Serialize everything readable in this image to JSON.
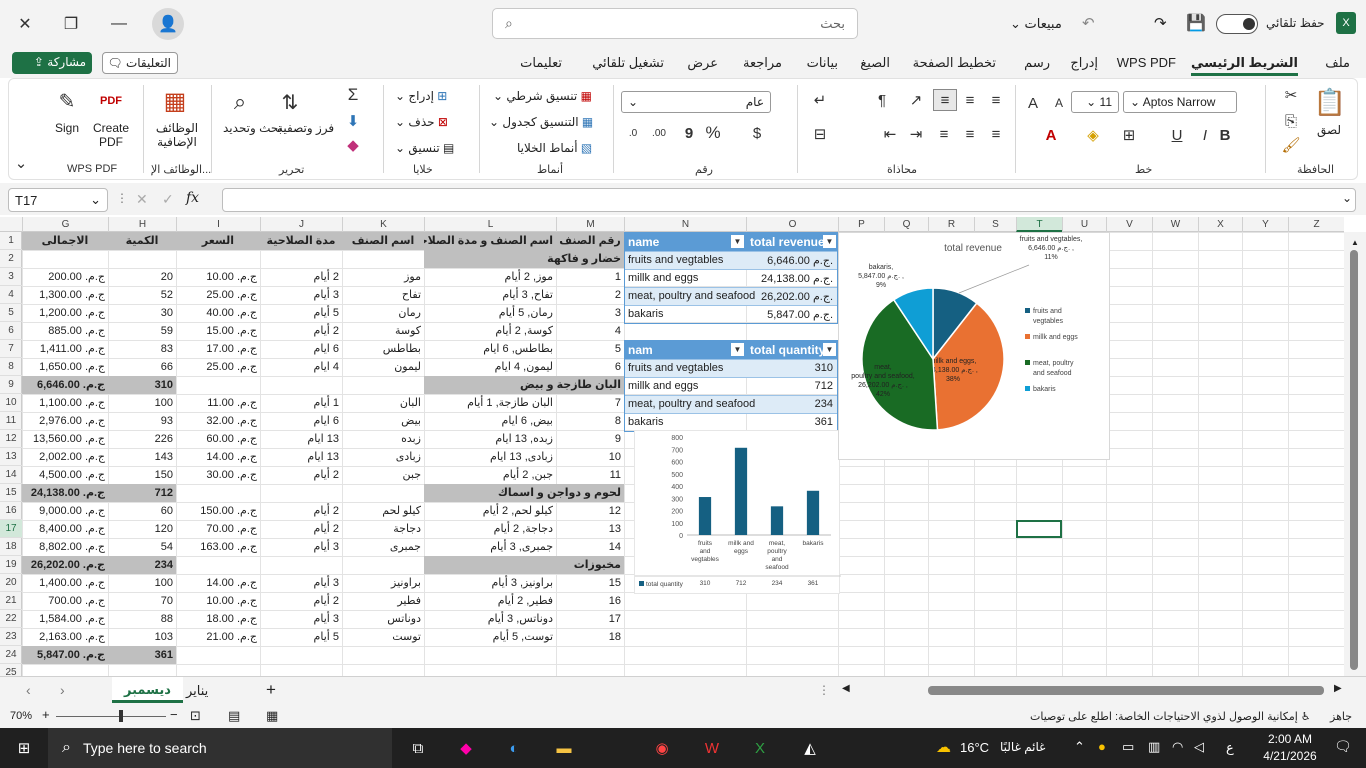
{
  "app": {
    "title": "مبيعات",
    "autosave": "حفظ تلقائي",
    "search_placeholder": "بحث"
  },
  "menu": [
    "ملف",
    "الشريط الرئيسي",
    "WPS PDF",
    "إدراج",
    "رسم",
    "تخطيط الصفحة",
    "الصيغ",
    "بيانات",
    "مراجعة",
    "عرض",
    "تشغيل تلقائي",
    "تعليمات"
  ],
  "actions": {
    "comments": "التعليقات",
    "share": "مشاركة"
  },
  "ribbon": {
    "clipboard": {
      "label": "الحافظة",
      "paste": "لصق"
    },
    "font": {
      "label": "خط",
      "name": "Aptos Narrow",
      "size": "11"
    },
    "align": {
      "label": "محاذاة"
    },
    "number": {
      "label": "رقم",
      "format": "عام"
    },
    "styles": {
      "label": "أنماط",
      "cond": "تنسيق شرطي",
      "table": "التنسيق كجدول",
      "cell": "أنماط الخلايا"
    },
    "cells": {
      "label": "خلايا",
      "insert": "إدراج",
      "delete": "حذف",
      "format": "تنسيق"
    },
    "edit": {
      "label": "تحرير",
      "sort": "فرز وتصفية",
      "find": "بحث وتحديد"
    },
    "addins": {
      "label": "الوظائف الإ...",
      "btn": "الوظائف الإضافية"
    },
    "wps": {
      "label": "WPS PDF",
      "create": "Create PDF",
      "sign": "Sign"
    }
  },
  "namebox": "T17",
  "columns": [
    "G",
    "H",
    "I",
    "J",
    "K",
    "L",
    "M",
    "N",
    "O",
    "P",
    "Q",
    "R",
    "S",
    "T",
    "U",
    "V",
    "W",
    "X",
    "Y",
    "Z"
  ],
  "rows": [
    "1",
    "2",
    "3",
    "4",
    "5",
    "6",
    "7",
    "8",
    "9",
    "10",
    "11",
    "12",
    "13",
    "14",
    "15",
    "16",
    "17",
    "18",
    "19",
    "20",
    "21",
    "22",
    "23",
    "24",
    "25"
  ],
  "table_header": {
    "total": "الاجمالى",
    "qty": "الكمية",
    "price": "السعر",
    "exp": "مدة الصلاحية",
    "name": "اسم الصنف",
    "combined": "اسم الصنف و مدة الصلاحية",
    "num": "رقم الصنف"
  },
  "table_rows": [
    {
      "r": 2,
      "cat": "خضار و فاكهة"
    },
    {
      "r": 3,
      "total": "ج.م. 200.00",
      "qty": "20",
      "price": "ج.م. 10.00",
      "exp": "2 أيام",
      "name": "موز",
      "comb": "موز, 2 أيام",
      "num": "1"
    },
    {
      "r": 4,
      "total": "ج.م. 1,300.00",
      "qty": "52",
      "price": "ج.م. 25.00",
      "exp": "3 أيام",
      "name": "تفاح",
      "comb": "تفاح, 3 أيام",
      "num": "2"
    },
    {
      "r": 5,
      "total": "ج.م. 1,200.00",
      "qty": "30",
      "price": "ج.م. 40.00",
      "exp": "5 أيام",
      "name": "رمان",
      "comb": "رمان, 5 أيام",
      "num": "3"
    },
    {
      "r": 6,
      "total": "ج.م. 885.00",
      "qty": "59",
      "price": "ج.م. 15.00",
      "exp": "2 أيام",
      "name": "كوسة",
      "comb": "كوسة, 2 أيام",
      "num": "4"
    },
    {
      "r": 7,
      "total": "ج.م. 1,411.00",
      "qty": "83",
      "price": "ج.م. 17.00",
      "exp": "6 ايام",
      "name": "بطاطس",
      "comb": "بطاطس, 6 ايام",
      "num": "5"
    },
    {
      "r": 8,
      "total": "ج.م. 1,650.00",
      "qty": "66",
      "price": "ج.م. 25.00",
      "exp": "4 ايام",
      "name": "ليمون",
      "comb": "ليمون, 4 ايام",
      "num": "6"
    },
    {
      "r": 9,
      "total": "ج.م. 6,646.00",
      "qty": "310",
      "cat": "البان طازجة و بيض",
      "sub": true
    },
    {
      "r": 10,
      "total": "ج.م. 1,100.00",
      "qty": "100",
      "price": "ج.م. 11.00",
      "exp": "1 أيام",
      "name": "البان",
      "comb": "البان طازجة, 1 أيام",
      "num": "7"
    },
    {
      "r": 11,
      "total": "ج.م. 2,976.00",
      "qty": "93",
      "price": "ج.م. 32.00",
      "exp": "6 ايام",
      "name": "بيض",
      "comb": "بيض, 6 ايام",
      "num": "8"
    },
    {
      "r": 12,
      "total": "ج.م. 13,560.00",
      "qty": "226",
      "price": "ج.م. 60.00",
      "exp": "13 ايام",
      "name": "زبده",
      "comb": "زبده, 13 ايام",
      "num": "9"
    },
    {
      "r": 13,
      "total": "ج.م. 2,002.00",
      "qty": "143",
      "price": "ج.م. 14.00",
      "exp": "13 ايام",
      "name": "زبادى",
      "comb": "زبادى, 13 ايام",
      "num": "10"
    },
    {
      "r": 14,
      "total": "ج.م. 4,500.00",
      "qty": "150",
      "price": "ج.م. 30.00",
      "exp": "2 أيام",
      "name": "جبن",
      "comb": "جبن, 2 أيام",
      "num": "11"
    },
    {
      "r": 15,
      "total": "ج.م. 24,138.00",
      "qty": "712",
      "cat": "لحوم و دواجن و اسماك",
      "sub": true
    },
    {
      "r": 16,
      "total": "ج.م. 9,000.00",
      "qty": "60",
      "price": "ج.م. 150.00",
      "exp": "2 أيام",
      "name": "كيلو لحم",
      "comb": "كيلو لحم, 2 أيام",
      "num": "12"
    },
    {
      "r": 17,
      "total": "ج.م. 8,400.00",
      "qty": "120",
      "price": "ج.م. 70.00",
      "exp": "2 أيام",
      "name": "دجاجة",
      "comb": "دجاجة, 2 أيام",
      "num": "13"
    },
    {
      "r": 18,
      "total": "ج.م. 8,802.00",
      "qty": "54",
      "price": "ج.م. 163.00",
      "exp": "3 أيام",
      "name": "جمبرى",
      "comb": "جمبرى, 3 أيام",
      "num": "14"
    },
    {
      "r": 19,
      "total": "ج.م. 26,202.00",
      "qty": "234",
      "cat": "مخبوزات",
      "sub": true
    },
    {
      "r": 20,
      "total": "ج.م. 1,400.00",
      "qty": "100",
      "price": "ج.م. 14.00",
      "exp": "3 أيام",
      "name": "براونيز",
      "comb": "براونيز, 3 أيام",
      "num": "15"
    },
    {
      "r": 21,
      "total": "ج.م. 700.00",
      "qty": "70",
      "price": "ج.م. 10.00",
      "exp": "2 أيام",
      "name": "فطير",
      "comb": "فطير, 2 أيام",
      "num": "16"
    },
    {
      "r": 22,
      "total": "ج.م. 1,584.00",
      "qty": "88",
      "price": "ج.م. 18.00",
      "exp": "3 أيام",
      "name": "دوناتس",
      "comb": "دوناتس, 3 أيام",
      "num": "17"
    },
    {
      "r": 23,
      "total": "ج.م. 2,163.00",
      "qty": "103",
      "price": "ج.م. 21.00",
      "exp": "5 أيام",
      "name": "توست",
      "comb": "توست, 5 أيام",
      "num": "18"
    },
    {
      "r": 24,
      "total": "ج.م. 5,847.00",
      "qty": "361",
      "sub": true
    }
  ],
  "pivot_rev": {
    "h1": "name",
    "h2": "total revenue",
    "rows": [
      [
        "fruits and vegtables",
        "6,646.00 ج.م."
      ],
      [
        "millk and eggs",
        "24,138.00 ج.م."
      ],
      [
        "meat, poultry and seafood",
        "26,202.00 ج.م."
      ],
      [
        "bakaris",
        "5,847.00 ج.م."
      ]
    ]
  },
  "pivot_qty": {
    "h1": "nam",
    "h2": "total quantity",
    "rows": [
      [
        "fruits and vegtables",
        "310"
      ],
      [
        "millk and eggs",
        "712"
      ],
      [
        "meat, poultry and seafood",
        "234"
      ],
      [
        "bakaris",
        "361"
      ]
    ]
  },
  "chart_data": [
    {
      "type": "bar",
      "categories": [
        "fruits and vegtables",
        "millk and eggs",
        "meat, poultry and seafood",
        "bakaris"
      ],
      "series": [
        {
          "name": "total quantity",
          "values": [
            310,
            712,
            234,
            361
          ]
        }
      ],
      "ylim": [
        0,
        800
      ],
      "yticks": [
        "0",
        "100",
        "200",
        "300",
        "400",
        "500",
        "600",
        "700",
        "800"
      ],
      "grid": false,
      "color": "#156082"
    },
    {
      "type": "pie",
      "title": "total revenue",
      "categories": [
        "fruits and vegtables",
        "millk and eggs",
        "meat, poultry and seafood",
        "bakaris"
      ],
      "values": [
        6646,
        24138,
        26202,
        5847
      ],
      "labels": [
        "fruits and vegtables, 6,646.00 ج.م. , 11%",
        "millk and eggs, 24,138.00 ج.م. , 38%",
        "meat, poultry and seafood, 26,202.00 ج.م. , 42%",
        "bakaris, 5,847.00 ج.م. , 9%"
      ],
      "colors": [
        "#156082",
        "#e97132",
        "#196b24",
        "#0f9ed5"
      ],
      "legend": "right"
    }
  ],
  "sheets": [
    "ديسمبر",
    "يناير"
  ],
  "status": {
    "zoom": "70%",
    "ready": "جاهز",
    "access": "إمكانية الوصول لذوي الاحتياجات الخاصة: اطلع على توصيات"
  },
  "taskbar": {
    "search": "Type here to search",
    "weather": "غائم غالبًا",
    "temp": "16°C",
    "time": "2:00 AM",
    "date": "4/21/2026",
    "lang": "ع"
  }
}
